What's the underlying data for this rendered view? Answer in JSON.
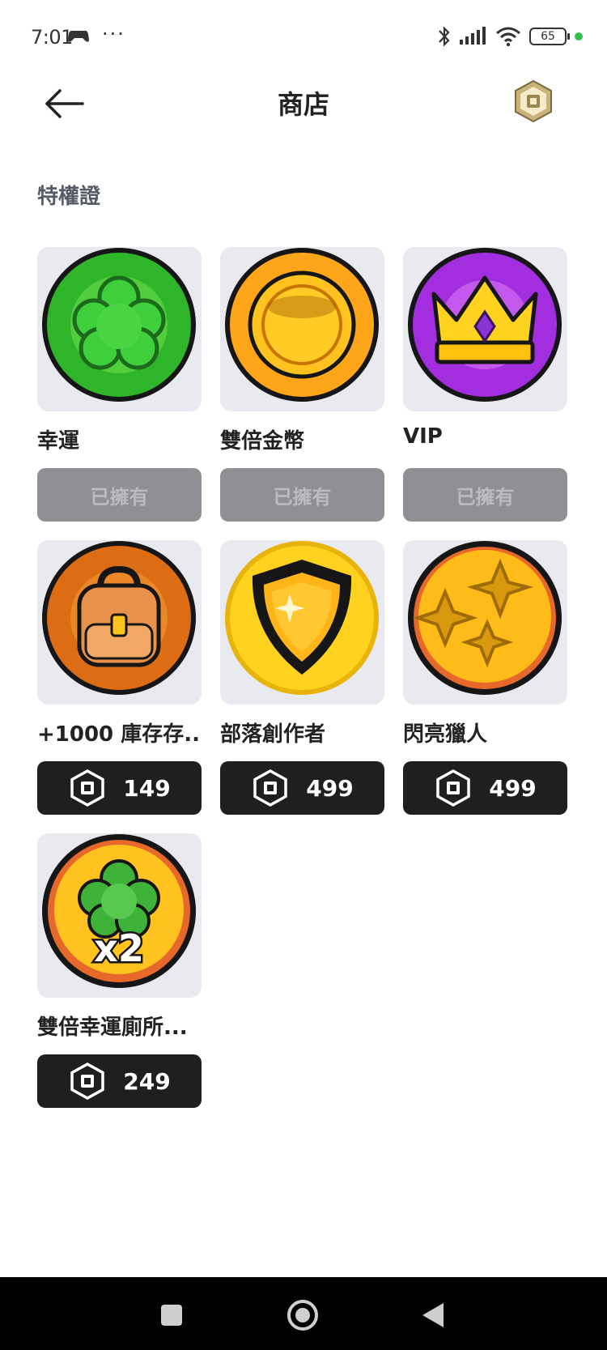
{
  "status_bar": {
    "time": "7:01",
    "more": "···",
    "battery": "65",
    "icons": [
      "gamepad-icon",
      "bluetooth-icon",
      "signal-icon",
      "wifi-icon",
      "battery-icon"
    ]
  },
  "header": {
    "title": "商店",
    "back_icon": "arrow-left-icon",
    "currency_icon": "robux-icon"
  },
  "section": {
    "title": "特權證"
  },
  "items": [
    {
      "name": "幸運",
      "button": "已擁有",
      "owned": true,
      "icon": "clover-badge"
    },
    {
      "name": "雙倍金幣",
      "button": "已擁有",
      "owned": true,
      "icon": "coin-badge"
    },
    {
      "name": "VIP",
      "button": "已擁有",
      "owned": true,
      "icon": "crown-badge"
    },
    {
      "name": "+1000 庫存存...",
      "price": "149",
      "owned": false,
      "icon": "backpack-badge"
    },
    {
      "name": "部落創作者",
      "price": "499",
      "owned": false,
      "icon": "shield-badge"
    },
    {
      "name": "閃亮獵人",
      "price": "499",
      "owned": false,
      "icon": "sparkle-badge"
    },
    {
      "name": "雙倍幸運廁所...",
      "price": "249",
      "owned": false,
      "icon": "clover-x2-badge"
    }
  ],
  "colors": {
    "owned_button_bg": "#8e9093",
    "buy_button_bg": "#1f1f1f",
    "thumb_bg": "#e9e9f0",
    "section_title": "#555b66"
  },
  "nav_bar": {
    "icons": [
      "recents-icon",
      "home-icon",
      "back-icon"
    ]
  }
}
